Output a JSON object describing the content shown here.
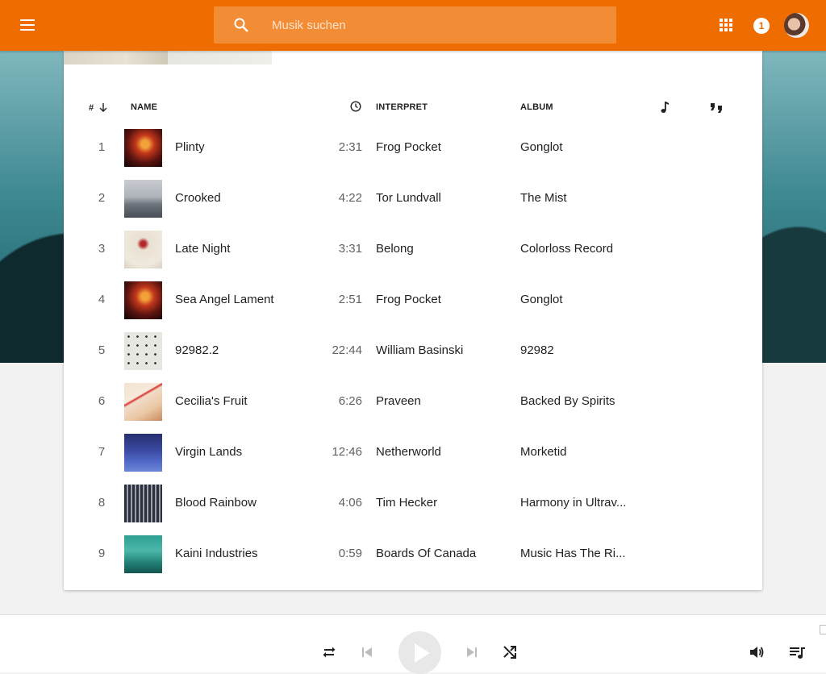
{
  "search": {
    "placeholder": "Musik suchen"
  },
  "header": {
    "notification_count": "1"
  },
  "table": {
    "headers": {
      "num": "#",
      "name": "NAME",
      "artist": "INTERPRET",
      "album": "ALBUM"
    },
    "rows": [
      {
        "num": "1",
        "title": "Plinty",
        "duration": "2:31",
        "artist": "Frog Pocket",
        "album": "Gonglot"
      },
      {
        "num": "2",
        "title": "Crooked",
        "duration": "4:22",
        "artist": "Tor Lundvall",
        "album": "The Mist"
      },
      {
        "num": "3",
        "title": "Late Night",
        "duration": "3:31",
        "artist": "Belong",
        "album": "Colorloss Record"
      },
      {
        "num": "4",
        "title": "Sea Angel Lament",
        "duration": "2:51",
        "artist": "Frog Pocket",
        "album": "Gonglot"
      },
      {
        "num": "5",
        "title": "92982.2",
        "duration": "22:44",
        "artist": "William Basinski",
        "album": "92982"
      },
      {
        "num": "6",
        "title": "Cecilia's Fruit",
        "duration": "6:26",
        "artist": "Praveen",
        "album": "Backed By Spirits"
      },
      {
        "num": "7",
        "title": "Virgin Lands",
        "duration": "12:46",
        "artist": "Netherworld",
        "album": "Morketid"
      },
      {
        "num": "8",
        "title": "Blood Rainbow",
        "duration": "4:06",
        "artist": "Tim Hecker",
        "album": "Harmony in Ultrav..."
      },
      {
        "num": "9",
        "title": "Kaini Industries",
        "duration": "0:59",
        "artist": "Boards Of Canada",
        "album": "Music Has The Ri..."
      }
    ]
  },
  "colors": {
    "accent": "#ef6c00",
    "search_bg": "#f28d35"
  },
  "icons": {
    "menu": "menu-icon",
    "search": "search-icon",
    "apps": "apps-grid-icon",
    "sort": "arrow-down-icon",
    "time": "clock-icon",
    "music": "music-note-icon",
    "quote": "quote-icon",
    "repeat": "repeat-icon",
    "prev": "skip-previous-icon",
    "play": "play-icon",
    "next": "skip-next-icon",
    "shuffle": "shuffle-icon",
    "volume": "volume-icon",
    "queue": "queue-music-icon"
  }
}
